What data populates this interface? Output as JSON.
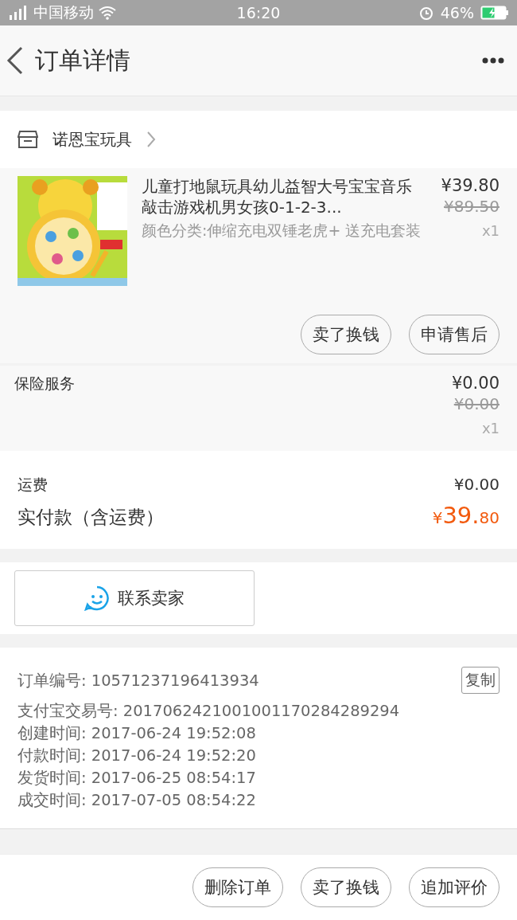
{
  "status_bar": {
    "carrier": "中国移动",
    "time": "16:20",
    "battery": "46%"
  },
  "header": {
    "title": "订单详情"
  },
  "shop": {
    "name": "诺恩宝玩具"
  },
  "product": {
    "image": {
      "kind": "picture"
    },
    "title": "儿童打地鼠玩具幼儿益智大号宝宝音乐敲击游戏机男女孩0-1-2-3...",
    "sku": "颜色分类:伸缩充电双锤老虎+ 送充电套装",
    "price": "¥39.80",
    "original_price": "¥89.50",
    "quantity": "x1",
    "actions": [
      "卖了换钱",
      "申请售后"
    ]
  },
  "insurance": {
    "label": "保险服务",
    "price": "¥0.00",
    "original_price": "¥0.00",
    "quantity": "x1"
  },
  "fees": {
    "shipping_label": "运费",
    "shipping": "¥0.00",
    "total_label": "实付款（含运费）",
    "total_currency": "¥",
    "total_int": "39.",
    "total_dec": "80"
  },
  "contact_button": "联系卖家",
  "info": {
    "rows": [
      {
        "label": "订单编号:",
        "value": "10571237196413934"
      },
      {
        "label": "支付宝交易号:",
        "value": "2017062421001001170284289294"
      },
      {
        "label": "创建时间:",
        "value": "2017-06-24 19:52:08"
      },
      {
        "label": "付款时间:",
        "value": "2017-06-24 19:52:20"
      },
      {
        "label": "发货时间:",
        "value": "2017-06-25 08:54:17"
      },
      {
        "label": "成交时间:",
        "value": "2017-07-05 08:54:22"
      }
    ],
    "copy_button": "复制"
  },
  "bottom_actions": [
    "删除订单",
    "卖了换钱",
    "追加评价"
  ]
}
